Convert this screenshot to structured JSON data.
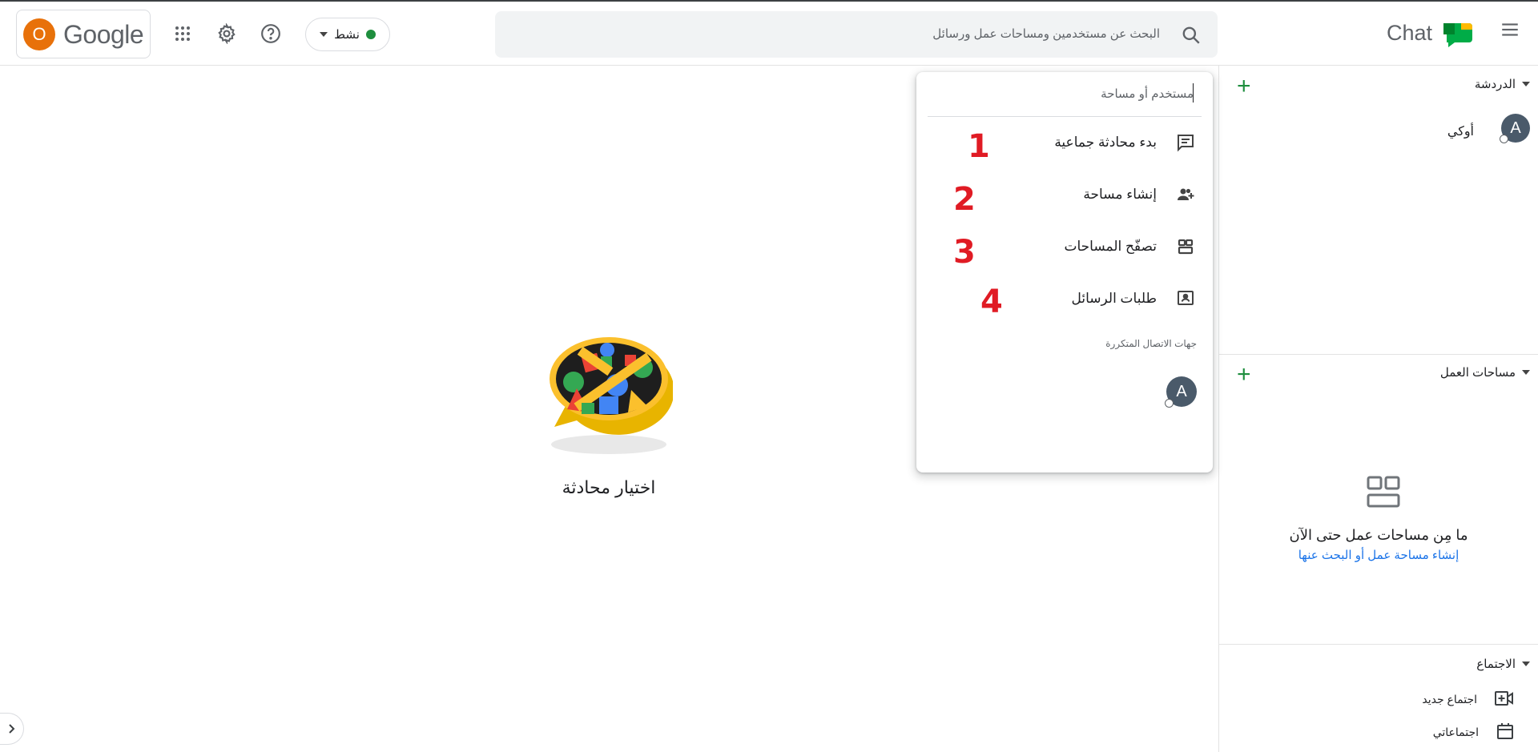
{
  "header": {
    "account_initial": "O",
    "google_wordmark": "Google",
    "status_label": "نشط",
    "search_placeholder": "البحث عن مستخدمين ومساحات عمل ورسائل",
    "app_title": "Chat"
  },
  "sidebar": {
    "chat_section_label": "الدردشة",
    "dm_items": [
      {
        "initial": "A",
        "name": "أوكي"
      }
    ],
    "spaces_section_label": "مساحات العمل",
    "spaces_empty_title": "ما مِن مساحات عمل حتى الآن",
    "spaces_empty_link": "إنشاء مساحة عمل أو البحث عنها",
    "meet_section_label": "الاجتماع",
    "meet_items": [
      {
        "label": "اجتماع جديد",
        "icon": "video-add-icon"
      },
      {
        "label": "اجتماعاتي",
        "icon": "calendar-icon"
      }
    ]
  },
  "main": {
    "empty_text": "اختيار محادثة"
  },
  "dropdown": {
    "input_placeholder": "مستخدم أو مساحة",
    "items": [
      {
        "label": "بدء محادثة جماعية",
        "icon": "chat-icon",
        "marker": "1"
      },
      {
        "label": "إنشاء مساحة",
        "icon": "group-add-icon",
        "marker": "2"
      },
      {
        "label": "تصفّح المساحات",
        "icon": "spaces-icon",
        "marker": "3"
      },
      {
        "label": "طلبات الرسائل",
        "icon": "message-request-icon",
        "marker": "4"
      }
    ],
    "frequent_label": "جهات الاتصال المتكررة",
    "frequent_contacts": [
      {
        "initial": "A"
      }
    ]
  },
  "colors": {
    "accent_green": "#1e8e3e",
    "link_blue": "#1a73e8",
    "marker_red": "#e01b24",
    "account_orange": "#e8710a"
  }
}
